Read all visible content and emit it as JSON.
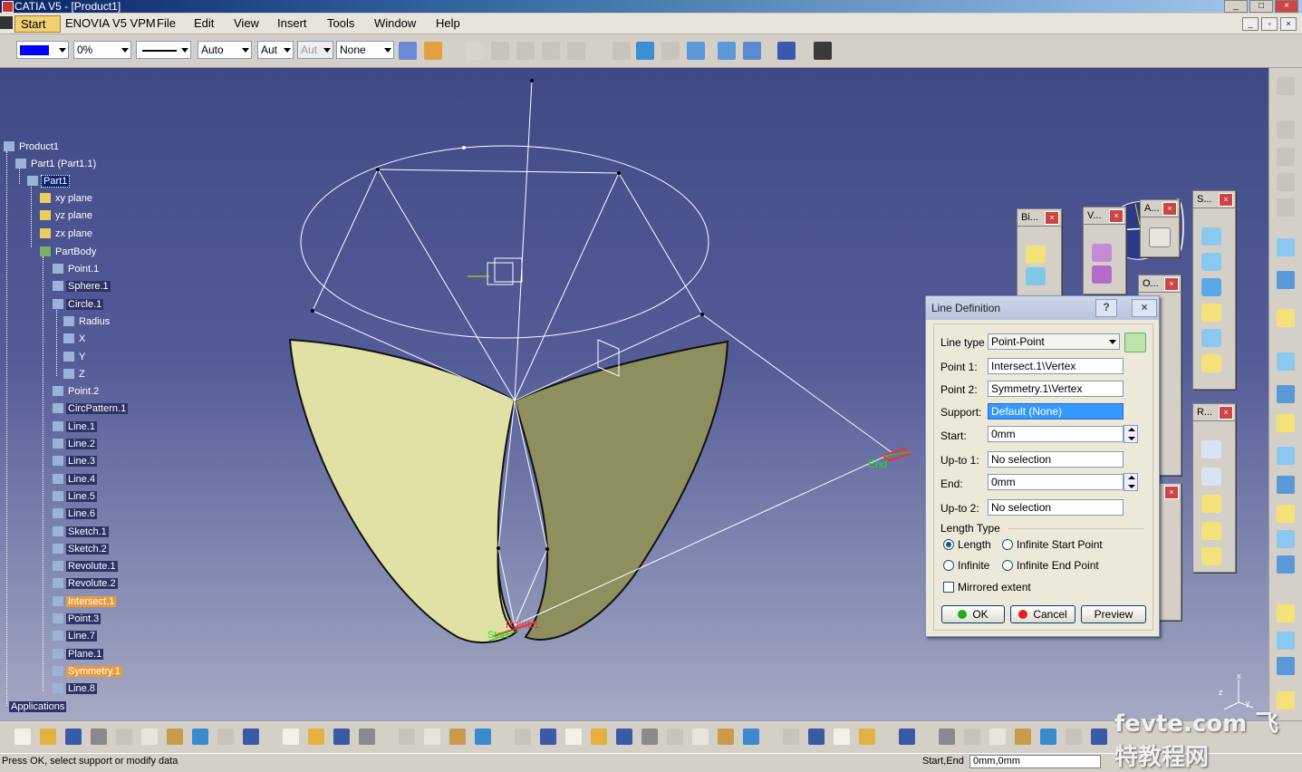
{
  "window": {
    "title": "CATIA V5 - [Product1]"
  },
  "menu": {
    "items": [
      "Start",
      "ENOVIA V5 VPM",
      "File",
      "Edit",
      "View",
      "Insert",
      "Tools",
      "Window",
      "Help"
    ]
  },
  "toolbar_top": {
    "color_value": "#0000ff",
    "transparency": "0%",
    "line_weight": "Auto",
    "line_type": "Aut",
    "point_symbol": "Aut",
    "layer": "None"
  },
  "tree": {
    "root": "Product1",
    "part_instance": "Part1 (Part1.1)",
    "part": "Part1",
    "planes": [
      "xy plane",
      "yz plane",
      "zx plane"
    ],
    "body": "PartBody",
    "items": [
      "Point.1",
      "Sphere.1",
      "Circle.1",
      "Radius",
      "X",
      "Y",
      "Z",
      "Point.2",
      "CircPattern.1",
      "Line.1",
      "Line.2",
      "Line.3",
      "Line.4",
      "Line.5",
      "Line.6",
      "Sketch.1",
      "Sketch.2",
      "Revolute.1",
      "Revolute.2",
      "Intersect.1",
      "Point.3",
      "Line.7",
      "Plane.1",
      "Symmetry.1",
      "Line.8"
    ],
    "applications": "Applications"
  },
  "viewport": {
    "annotations": {
      "end": "End",
      "point1": "Point.1",
      "start": "Start"
    },
    "axis_labels": {
      "x": "x",
      "y": "y",
      "z": "z"
    }
  },
  "mini_toolbars": [
    {
      "title": "Bi..."
    },
    {
      "title": "V..."
    },
    {
      "title": "A..."
    },
    {
      "title": "S..."
    },
    {
      "title": "O..."
    },
    {
      "title": "R..."
    }
  ],
  "dialog": {
    "title": "Line Definition",
    "help": "?",
    "close": "×",
    "line_type_label": "Line type :",
    "line_type_value": "Point-Point",
    "point1_label": "Point 1:",
    "point1_value": "Intersect.1\\Vertex",
    "point2_label": "Point 2:",
    "point2_value": "Symmetry.1\\Vertex",
    "support_label": "Support:",
    "support_value": "Default (None)",
    "start_label": "Start:",
    "start_value": "0mm",
    "upto1_label": "Up-to 1:",
    "upto1_value": "No selection",
    "end_label": "End:",
    "end_value": "0mm",
    "upto2_label": "Up-to 2:",
    "upto2_value": "No selection",
    "length_type_label": "Length Type",
    "length_options": {
      "length": "Length",
      "infinite_start": "Infinite Start Point",
      "infinite": "Infinite",
      "infinite_end": "Infinite End Point"
    },
    "selected_length_option": "Length",
    "mirrored_extent": "Mirrored extent",
    "mirrored_checked": false,
    "ok": "OK",
    "cancel": "Cancel",
    "preview": "Preview"
  },
  "status": {
    "message": "Press OK, select support or modify data",
    "right_label": "Start,End",
    "right_value": "0mm,0mm"
  },
  "watermark": "fevte.com 飞特教程网",
  "colors": {
    "viewport_top": "#3f4a85",
    "viewport_bottom": "#a6a9c4",
    "surface_light": "#d9dc9a",
    "surface_dark": "#8e8f5e",
    "highlight_orange": "#e89a3c",
    "selection_blue": "#0a246a"
  }
}
